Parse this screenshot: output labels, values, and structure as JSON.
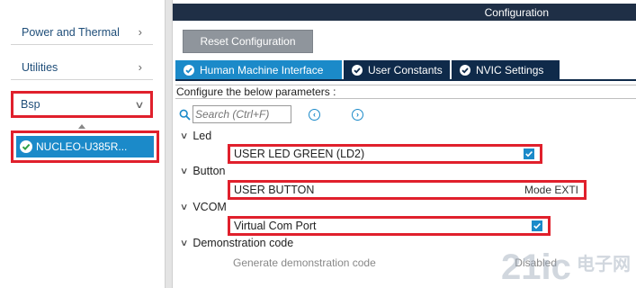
{
  "sidebar": {
    "items": [
      {
        "label": "Power and Thermal",
        "chevron": ">"
      },
      {
        "label": "Utilities",
        "chevron": ">"
      },
      {
        "label": "Bsp",
        "chevron": "v"
      }
    ],
    "selected_board": "NUCLEO-U385R..."
  },
  "config": {
    "title": "Configuration",
    "reset_label": "Reset Configuration",
    "tabs": [
      {
        "label": "Human Machine Interface",
        "active": true
      },
      {
        "label": "User Constants",
        "active": false
      },
      {
        "label": "NVIC Settings",
        "active": false
      }
    ],
    "instruction": "Configure the below parameters :",
    "search": {
      "placeholder": "Search (Ctrl+F)"
    },
    "groups": {
      "led": {
        "title": "Led",
        "param": {
          "label": "USER LED GREEN (LD2)",
          "checked": true
        }
      },
      "button": {
        "title": "Button",
        "param": {
          "label": "USER BUTTON",
          "value": "Mode EXTI"
        }
      },
      "vcom": {
        "title": "VCOM",
        "param": {
          "label": "Virtual Com Port",
          "checked": true
        }
      },
      "demo": {
        "title": "Demonstration code",
        "param": {
          "label": "Generate demonstration code",
          "value": "Disabled"
        }
      }
    }
  },
  "colors": {
    "accent": "#1b8ac9",
    "header_dark": "#1f2f46",
    "tab_dark": "#0f2a4a",
    "highlight_box": "#e0202c",
    "nav_text": "#1f4e79"
  },
  "watermark": {
    "text": "21ic 电子网"
  }
}
